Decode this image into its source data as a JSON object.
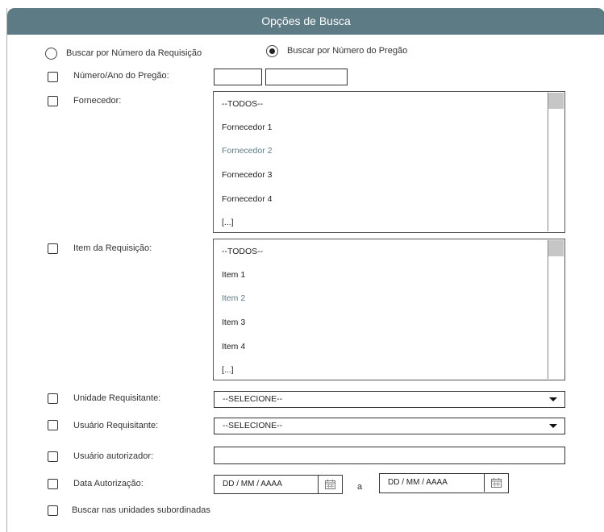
{
  "header": {
    "title": "Opções de Busca"
  },
  "search_mode": {
    "option_requisicao": "Buscar por Número da Requisição",
    "option_pregao": "Buscar por Número do Pregão",
    "selected": "pregao"
  },
  "fields": {
    "numero_pregao": {
      "label": "Número/Ano do Pregão:",
      "numero_value": "",
      "ano_value": ""
    },
    "fornecedor": {
      "label": "Fornecedor:",
      "options": [
        "--TODOS--",
        "Fornecedor 1",
        "Fornecedor 2",
        "Fornecedor 3",
        "Fornecedor 4",
        "[...]"
      ]
    },
    "item_requisicao": {
      "label": "Item da Requisição:",
      "options": [
        "--TODOS--",
        "Item 1",
        "Item 2",
        "Item 3",
        "Item 4",
        "[...]"
      ]
    },
    "unidade_requisitante": {
      "label": "Unidade Requisitante:",
      "value": "--SELECIONE--"
    },
    "usuario_requisitante": {
      "label": "Usuário Requisitante:",
      "value": "--SELECIONE--"
    },
    "usuario_autorizador": {
      "label": "Usuário autorizador:",
      "value": ""
    },
    "data_autorizacao": {
      "label": "Data Autorização:",
      "from_placeholder": "DD / MM / AAAA",
      "separator": "a",
      "to_placeholder": "DD / MM / AAAA"
    },
    "subordinadas": {
      "label": "Buscar nas unidades subordinadas"
    }
  },
  "colors": {
    "header_bg": "#5d7b85",
    "highlight_text": "#5d7b85"
  },
  "icons": {
    "calendar": "calendar-icon",
    "dropdown": "chevron-down-icon"
  }
}
